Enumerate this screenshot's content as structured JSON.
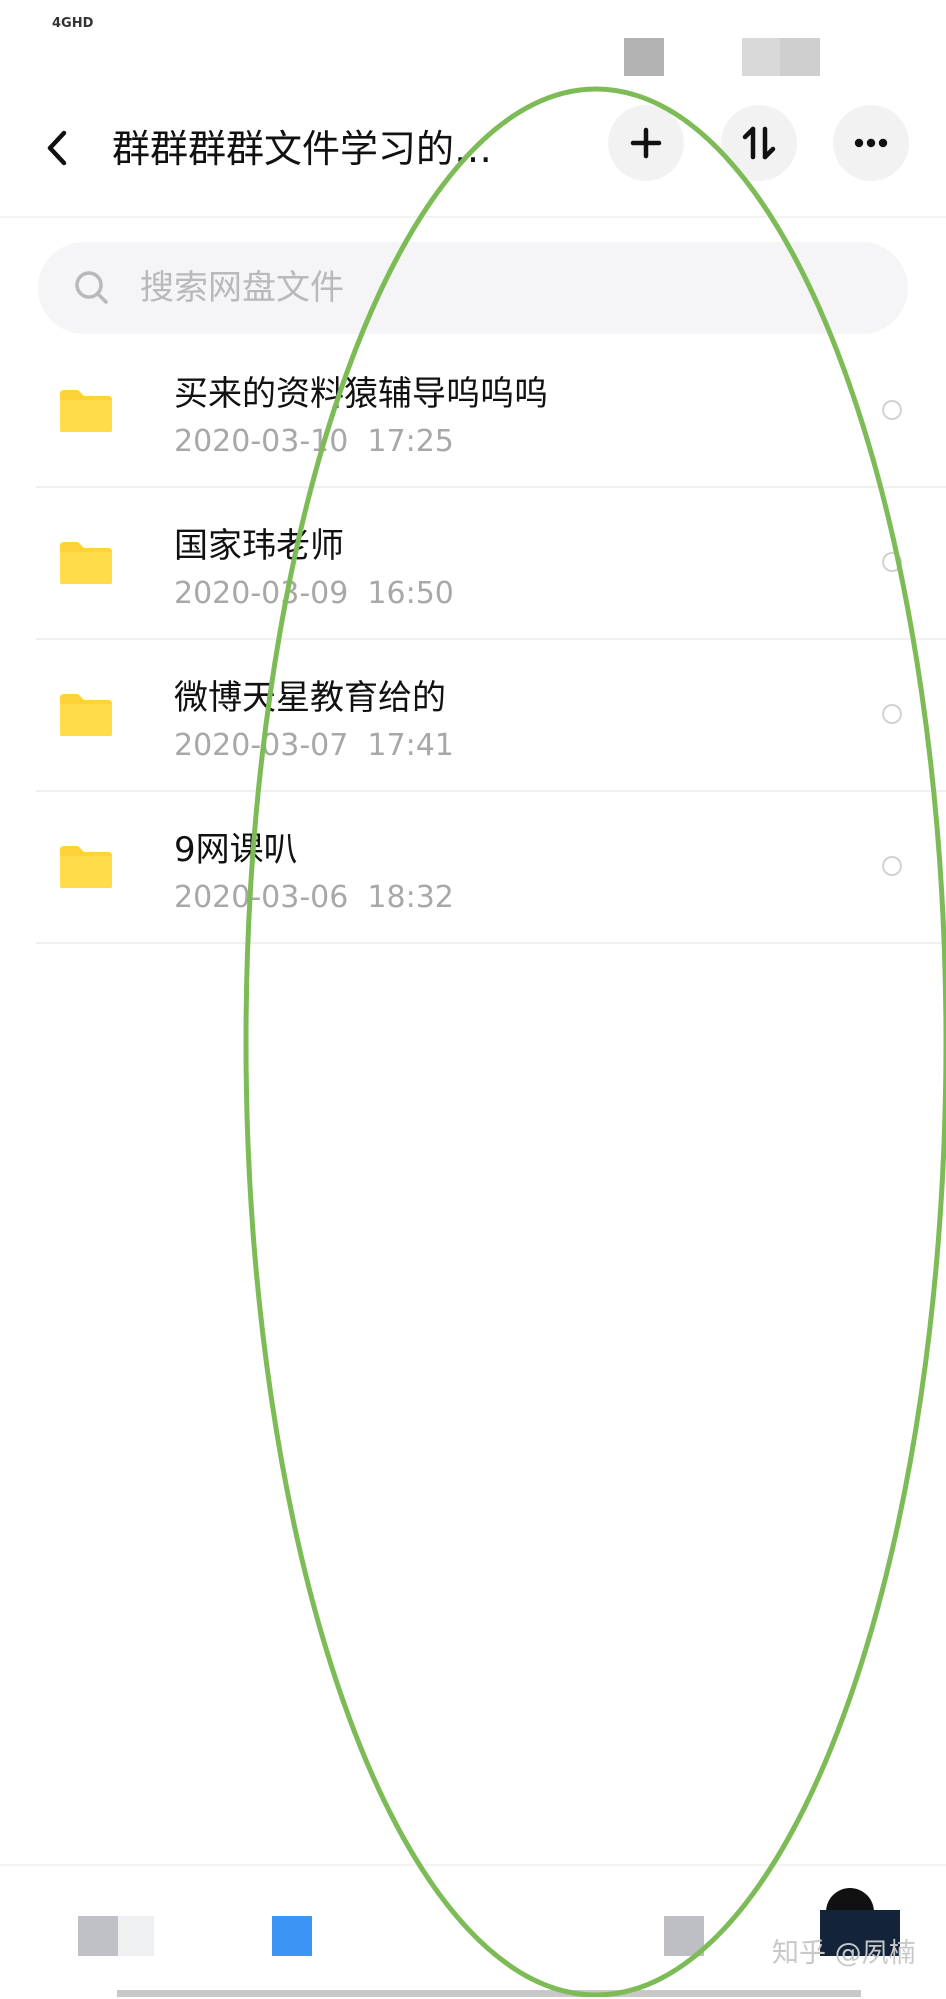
{
  "status_bar": {
    "signal": "4GHD"
  },
  "header": {
    "title": "群群群群文件学习的…",
    "icons": {
      "back": "chevron-left-icon",
      "add": "plus-icon",
      "sort": "sort-arrows-icon",
      "more": "ellipsis-icon"
    }
  },
  "search": {
    "placeholder": "搜索网盘文件",
    "icon": "search-icon"
  },
  "files": [
    {
      "name": "买来的资料猿辅导呜呜呜",
      "date": "2020-03-10  17:25"
    },
    {
      "name": "国家玮老师",
      "date": "2020-03-09  16:50"
    },
    {
      "name": "微博天星教育给的",
      "date": "2020-03-07  17:41"
    },
    {
      "name": "9网课叭",
      "date": "2020-03-06  18:32"
    }
  ],
  "watermark": "知乎 @夙楠",
  "colors": {
    "folder": "#ffd23a",
    "annotation": "#7dbb57",
    "accent": "#3b95f5",
    "date_text": "#a8a8a8"
  }
}
